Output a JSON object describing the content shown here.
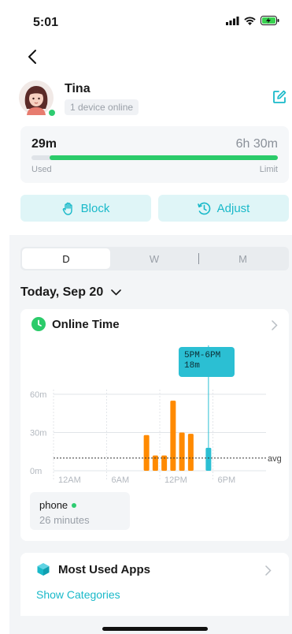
{
  "status_bar": {
    "time": "5:01"
  },
  "profile": {
    "name": "Tina",
    "devices_online": "1 device online"
  },
  "usage": {
    "used_value": "29m",
    "limit_value": "6h 30m",
    "used_label": "Used",
    "limit_label": "Limit",
    "used_fraction": 0.074
  },
  "actions": {
    "block_label": "Block",
    "adjust_label": "Adjust"
  },
  "period_tabs": [
    "D",
    "W",
    "M"
  ],
  "selected_tab": "D",
  "date_label": "Today, Sep 20",
  "online_time": {
    "title": "Online Time",
    "tooltip_range": "5PM-6PM",
    "tooltip_value": "18m",
    "device_name": "phone",
    "device_minutes": "26 minutes"
  },
  "chart_data": {
    "type": "bar",
    "x_tick_labels": [
      "12AM",
      "6AM",
      "12PM",
      "6PM"
    ],
    "y_tick_labels": [
      "60m",
      "30m",
      "0m"
    ],
    "ylim": [
      0,
      60
    ],
    "avg_label": "avg",
    "avg_value": 10,
    "hours": [
      10,
      11,
      12,
      13,
      14,
      15,
      16,
      17
    ],
    "minutes": [
      28,
      12,
      12,
      55,
      30,
      29,
      0,
      18
    ],
    "highlighted_hour": 17,
    "bar_color": "#ff8a00",
    "highlight_color": "#2bbfd3"
  },
  "most_used_apps": {
    "title": "Most Used Apps",
    "show_categories": "Show Categories"
  },
  "colors": {
    "accent": "#19b9c9",
    "progress": "#2bcb6a",
    "online": "#2ecc71"
  }
}
